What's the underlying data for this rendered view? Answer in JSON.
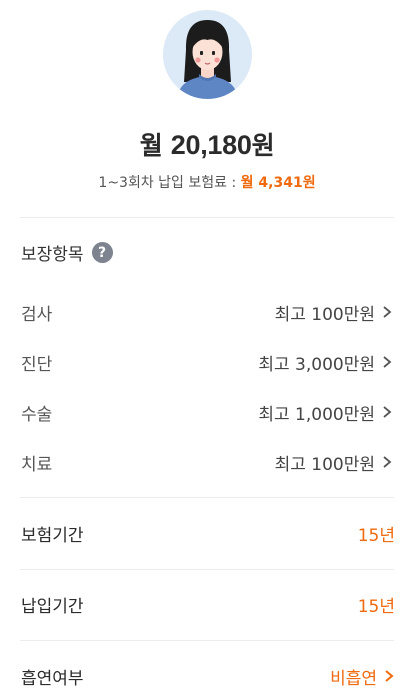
{
  "premium": {
    "prefix": "월 ",
    "amount": "20,180",
    "suffix": "원"
  },
  "subline": {
    "text": "1~3회차 납입 보험료 : ",
    "amount": "월 4,341원"
  },
  "coverage": {
    "title": "보장항목",
    "help_icon": "?",
    "items": [
      {
        "label": "검사",
        "value": "최고 100만원"
      },
      {
        "label": "진단",
        "value": "최고 3,000만원"
      },
      {
        "label": "수술",
        "value": "최고 1,000만원"
      },
      {
        "label": "치료",
        "value": "최고 100만원"
      }
    ]
  },
  "info": {
    "insurance_period": {
      "label": "보험기간",
      "value": "15년"
    },
    "payment_period": {
      "label": "납입기간",
      "value": "15년"
    },
    "smoking": {
      "label": "흡연여부",
      "value": "비흡연"
    }
  },
  "colors": {
    "accent": "#f06a0f",
    "avatar_bg": "#dce9f6",
    "help_icon": "#7d8490"
  },
  "icons": [
    "avatar",
    "help-icon",
    "chevron-right-icon"
  ]
}
